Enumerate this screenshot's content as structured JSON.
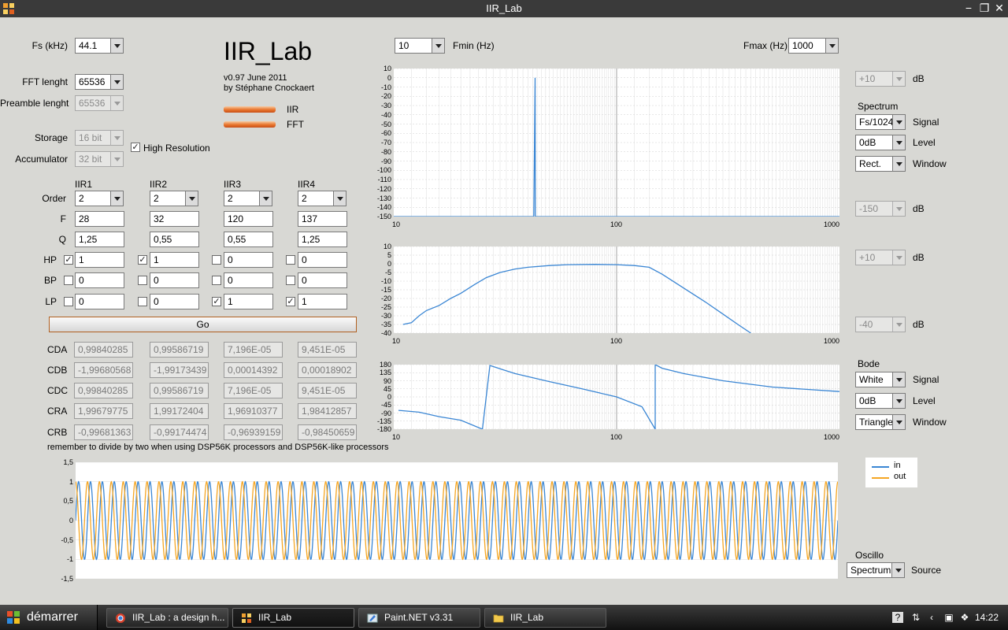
{
  "window": {
    "title": "IIR_Lab"
  },
  "app": {
    "title": "IIR_Lab",
    "version": "v0.97 June 2011",
    "author": "by Stéphane Cnockaert",
    "indicators": {
      "iir": "IIR",
      "fft": "FFT"
    }
  },
  "settings": {
    "fs_label": "Fs (kHz)",
    "fs_value": "44.1",
    "fft_length_label": "FFT lenght",
    "fft_length_value": "65536",
    "preamble_label": "Preamble lenght",
    "preamble_value": "65536",
    "storage_label": "Storage",
    "storage_value": "16 bit",
    "accumulator_label": "Accumulator",
    "accumulator_value": "32 bit",
    "high_resolution_label": "High Resolution",
    "high_resolution_checked": true
  },
  "filters": {
    "row_labels": {
      "order": "Order",
      "f": "F",
      "q": "Q",
      "hp": "HP",
      "bp": "BP",
      "lp": "LP"
    },
    "columns": [
      {
        "name": "IIR1",
        "order": "2",
        "f": "28",
        "q": "1,25",
        "hp": "1",
        "bp": "0",
        "lp": "0",
        "hp_checked": true,
        "bp_checked": false,
        "lp_checked": false
      },
      {
        "name": "IIR2",
        "order": "2",
        "f": "32",
        "q": "0,55",
        "hp": "1",
        "bp": "0",
        "lp": "0",
        "hp_checked": true,
        "bp_checked": false,
        "lp_checked": false
      },
      {
        "name": "IIR3",
        "order": "2",
        "f": "120",
        "q": "0,55",
        "hp": "0",
        "bp": "0",
        "lp": "1",
        "hp_checked": false,
        "bp_checked": false,
        "lp_checked": true
      },
      {
        "name": "IIR4",
        "order": "2",
        "f": "137",
        "q": "1,25",
        "hp": "0",
        "bp": "0",
        "lp": "1",
        "hp_checked": false,
        "bp_checked": false,
        "lp_checked": true
      }
    ],
    "go_label": "Go"
  },
  "coefficients": {
    "rows": [
      {
        "label": "CDA",
        "values": [
          "0,99840285",
          "0,99586719",
          "7,196E-05",
          "9,451E-05"
        ]
      },
      {
        "label": "CDB",
        "values": [
          "-1,99680568",
          "-1,99173439",
          "0,00014392",
          "0,00018902"
        ]
      },
      {
        "label": "CDC",
        "values": [
          "0,99840285",
          "0,99586719",
          "7,196E-05",
          "9,451E-05"
        ]
      },
      {
        "label": "CRA",
        "values": [
          "1,99679775",
          "1,99172404",
          "1,96910377",
          "1,98412857"
        ]
      },
      {
        "label": "CRB",
        "values": [
          "-0,99681363",
          "-0,99174474",
          "-0,96939159",
          "-0,98450659"
        ]
      }
    ],
    "note": "remember to divide by two when using DSP56K processors and DSP56K-like processors"
  },
  "range": {
    "fmin_value": "10",
    "fmin_label": "Fmin (Hz)",
    "fmax_label": "Fmax (Hz)",
    "fmax_value": "1000"
  },
  "spectrum": {
    "top_value": "+10",
    "top_unit": "dB",
    "section_label": "Spectrum",
    "signal_value": "Fs/1024",
    "signal_label": "Signal",
    "level_value": "0dB",
    "level_label": "Level",
    "window_value": "Rect.",
    "window_label": "Window",
    "bottom_value": "-150",
    "bottom_unit": "dB"
  },
  "magnitude": {
    "top_value": "+10",
    "top_unit": "dB",
    "bottom_value": "-40",
    "bottom_unit": "dB"
  },
  "bode": {
    "section_label": "Bode",
    "signal_value": "White",
    "signal_label": "Signal",
    "level_value": "0dB",
    "level_label": "Level",
    "window_value": "Triangle",
    "window_label": "Window"
  },
  "oscillo": {
    "section_label": "Oscillo",
    "source_value": "Spectrum",
    "source_label": "Source"
  },
  "colors": {
    "series_in": "#3a86d4",
    "series_out": "#f5a623",
    "accent": "#e8742c"
  },
  "chart_data": [
    {
      "type": "line",
      "name": "spectrum",
      "xscale": "log",
      "xlim": [
        10,
        1000
      ],
      "ylim": [
        -150,
        10
      ],
      "xticks": [
        "10",
        "100",
        "1000"
      ],
      "yticks": [
        "10",
        "0",
        "-10",
        "-20",
        "-30",
        "-40",
        "-50",
        "-60",
        "-70",
        "-80",
        "-90",
        "-100",
        "-110",
        "-120",
        "-130",
        "-140",
        "-150"
      ],
      "x": [
        10,
        42.5,
        43.07,
        43.2,
        1000
      ],
      "y": [
        -150,
        -150,
        0,
        -150,
        -150
      ]
    },
    {
      "type": "line",
      "name": "magnitude",
      "xscale": "log",
      "xlim": [
        10,
        1000
      ],
      "ylim": [
        -40,
        10
      ],
      "xticks": [
        "10",
        "100",
        "1000"
      ],
      "yticks": [
        "10",
        "5",
        "0",
        "-5",
        "-10",
        "-15",
        "-20",
        "-25",
        "-30",
        "-35",
        "-40"
      ],
      "x": [
        11,
        12,
        13,
        14,
        16,
        18,
        20,
        23,
        26,
        30,
        35,
        40,
        50,
        60,
        80,
        100,
        120,
        140,
        160,
        200,
        250,
        300,
        350,
        400
      ],
      "y": [
        -35,
        -34,
        -30,
        -27,
        -24,
        -20,
        -17,
        -12,
        -8,
        -5,
        -3,
        -2,
        -1,
        -0.5,
        -0.3,
        -0.5,
        -1,
        -2,
        -6,
        -14,
        -22,
        -29,
        -35,
        -40
      ]
    },
    {
      "type": "line",
      "name": "phase",
      "xscale": "log",
      "xlim": [
        10,
        1000
      ],
      "ylim": [
        -180,
        180
      ],
      "xticks": [
        "10",
        "100",
        "1000"
      ],
      "yticks": [
        "180",
        "135",
        "90",
        "45",
        "0",
        "-45",
        "-90",
        "-135",
        "-180"
      ],
      "x": [
        10.5,
        13,
        16,
        20,
        25,
        25,
        27,
        35,
        50,
        70,
        100,
        130,
        149,
        149,
        160,
        200,
        300,
        500,
        1000
      ],
      "y": [
        -75,
        -85,
        -110,
        -130,
        -180,
        -180,
        175,
        130,
        85,
        45,
        0,
        -55,
        -180,
        180,
        160,
        130,
        90,
        55,
        30
      ]
    },
    {
      "type": "line",
      "name": "oscillo",
      "xlim": [
        0,
        1
      ],
      "ylim": [
        -1.5,
        1.5
      ],
      "yticks": [
        "1,5",
        "1",
        "0,5",
        "0",
        "-0,5",
        "-1",
        "-1,5"
      ],
      "cycles": 64,
      "amplitude": 1,
      "series": [
        {
          "name": "in"
        },
        {
          "name": "out"
        }
      ]
    }
  ],
  "legend": {
    "in_label": "in",
    "out_label": "out"
  },
  "taskbar": {
    "start_label": "démarrer",
    "tasks": [
      "IIR_Lab : a design h...",
      "IIR_Lab",
      "Paint.NET v3.31",
      "IIR_Lab"
    ],
    "clock": "14:22"
  }
}
